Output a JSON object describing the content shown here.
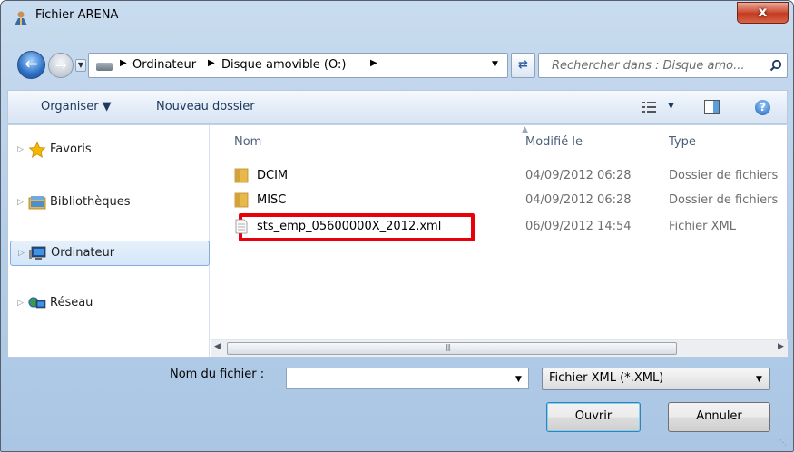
{
  "window": {
    "title": "Fichier ARENA",
    "close_label": "x"
  },
  "address": {
    "segments": [
      "Ordinateur",
      "Disque amovible (O:)"
    ],
    "separator": "▶"
  },
  "search": {
    "placeholder": "Rechercher dans : Disque amo..."
  },
  "toolbar": {
    "organize_label": "Organiser ▼",
    "new_folder_label": "Nouveau dossier"
  },
  "sidebar": {
    "items": [
      {
        "label": "Favoris",
        "icon": "star-icon",
        "selected": false
      },
      {
        "label": "Bibliothèques",
        "icon": "libraries-icon",
        "selected": false
      },
      {
        "label": "Ordinateur",
        "icon": "computer-icon",
        "selected": true
      },
      {
        "label": "Réseau",
        "icon": "network-icon",
        "selected": false
      }
    ]
  },
  "columns": {
    "name": "Nom",
    "modified": "Modifié le",
    "type": "Type"
  },
  "files": [
    {
      "name": "DCIM",
      "modified": "04/09/2012 06:28",
      "type": "Dossier de fichiers",
      "icon": "folder-icon"
    },
    {
      "name": "MISC",
      "modified": "04/09/2012 06:28",
      "type": "Dossier de fichiers",
      "icon": "folder-icon"
    },
    {
      "name": "sts_emp_05600000X_2012.xml",
      "modified": "06/09/2012 14:54",
      "type": "Fichier XML",
      "icon": "xml-file-icon",
      "highlighted": true
    }
  ],
  "footer": {
    "filename_label": "Nom du fichier :",
    "filename_value": "",
    "filter_value": "Fichier XML (*.XML)",
    "open_label": "Ouvrir",
    "cancel_label": "Annuler"
  },
  "colors": {
    "highlight": "#e8000b",
    "selection": "#d4e6fa",
    "accent": "#1e395b"
  }
}
